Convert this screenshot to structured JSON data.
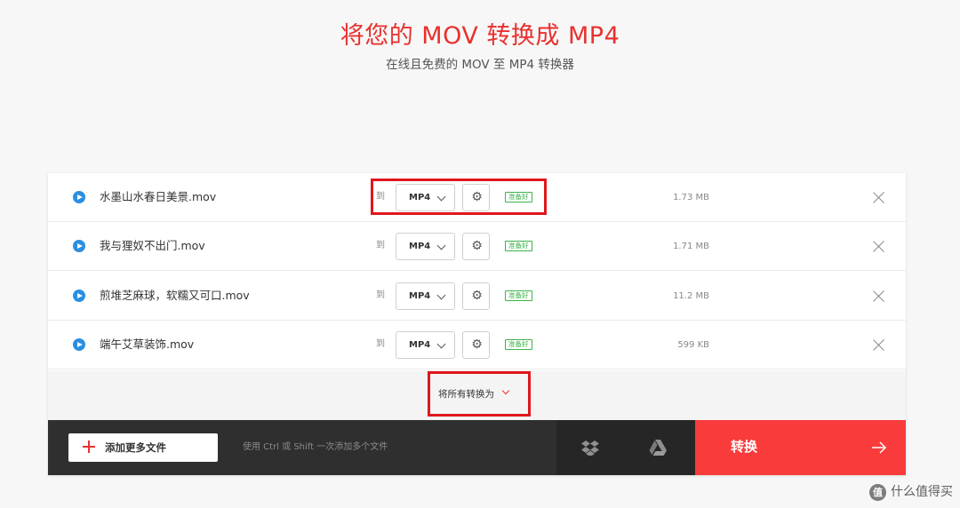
{
  "header": {
    "title": "将您的 MOV 转换成 MP4",
    "subtitle": "在线且免费的 MOV 至 MP4 转换器"
  },
  "files": [
    {
      "name": "水墨山水春日美景.mov",
      "to_label": "到",
      "format": "MP4",
      "status": "准备好",
      "size": "1.73 MB"
    },
    {
      "name": "我与狸奴不出门.mov",
      "to_label": "到",
      "format": "MP4",
      "status": "准备好",
      "size": "1.71 MB"
    },
    {
      "name": "煎堆芝麻球，软糯又可口.mov",
      "to_label": "到",
      "format": "MP4",
      "status": "准备好",
      "size": "11.2 MB"
    },
    {
      "name": "端午艾草装饰.mov",
      "to_label": "到",
      "format": "MP4",
      "status": "准备好",
      "size": "599 KB"
    }
  ],
  "convert_all": {
    "label": "将所有转换为"
  },
  "bottom_bar": {
    "add_files_label": "添加更多文件",
    "hint": "使用 Ctrl 或 Shift 一次添加多个文件",
    "convert_label": "转换"
  },
  "icons": {
    "play": "play-icon",
    "settings": "gear-icon",
    "remove": "close-icon",
    "add": "plus-icon",
    "dropbox": "dropbox-icon",
    "google_drive": "google-drive-icon",
    "submit": "arrow-right-icon"
  },
  "colors": {
    "accent_red": "#e8312f",
    "convert_button": "#fa3b3b",
    "play_blue": "#2b8fe0",
    "status_green": "#3cb34a",
    "bottom_bar": "#2f2f2f",
    "highlight": "#e0161c"
  },
  "watermark": {
    "logo": "值",
    "text": "什么值得买"
  }
}
